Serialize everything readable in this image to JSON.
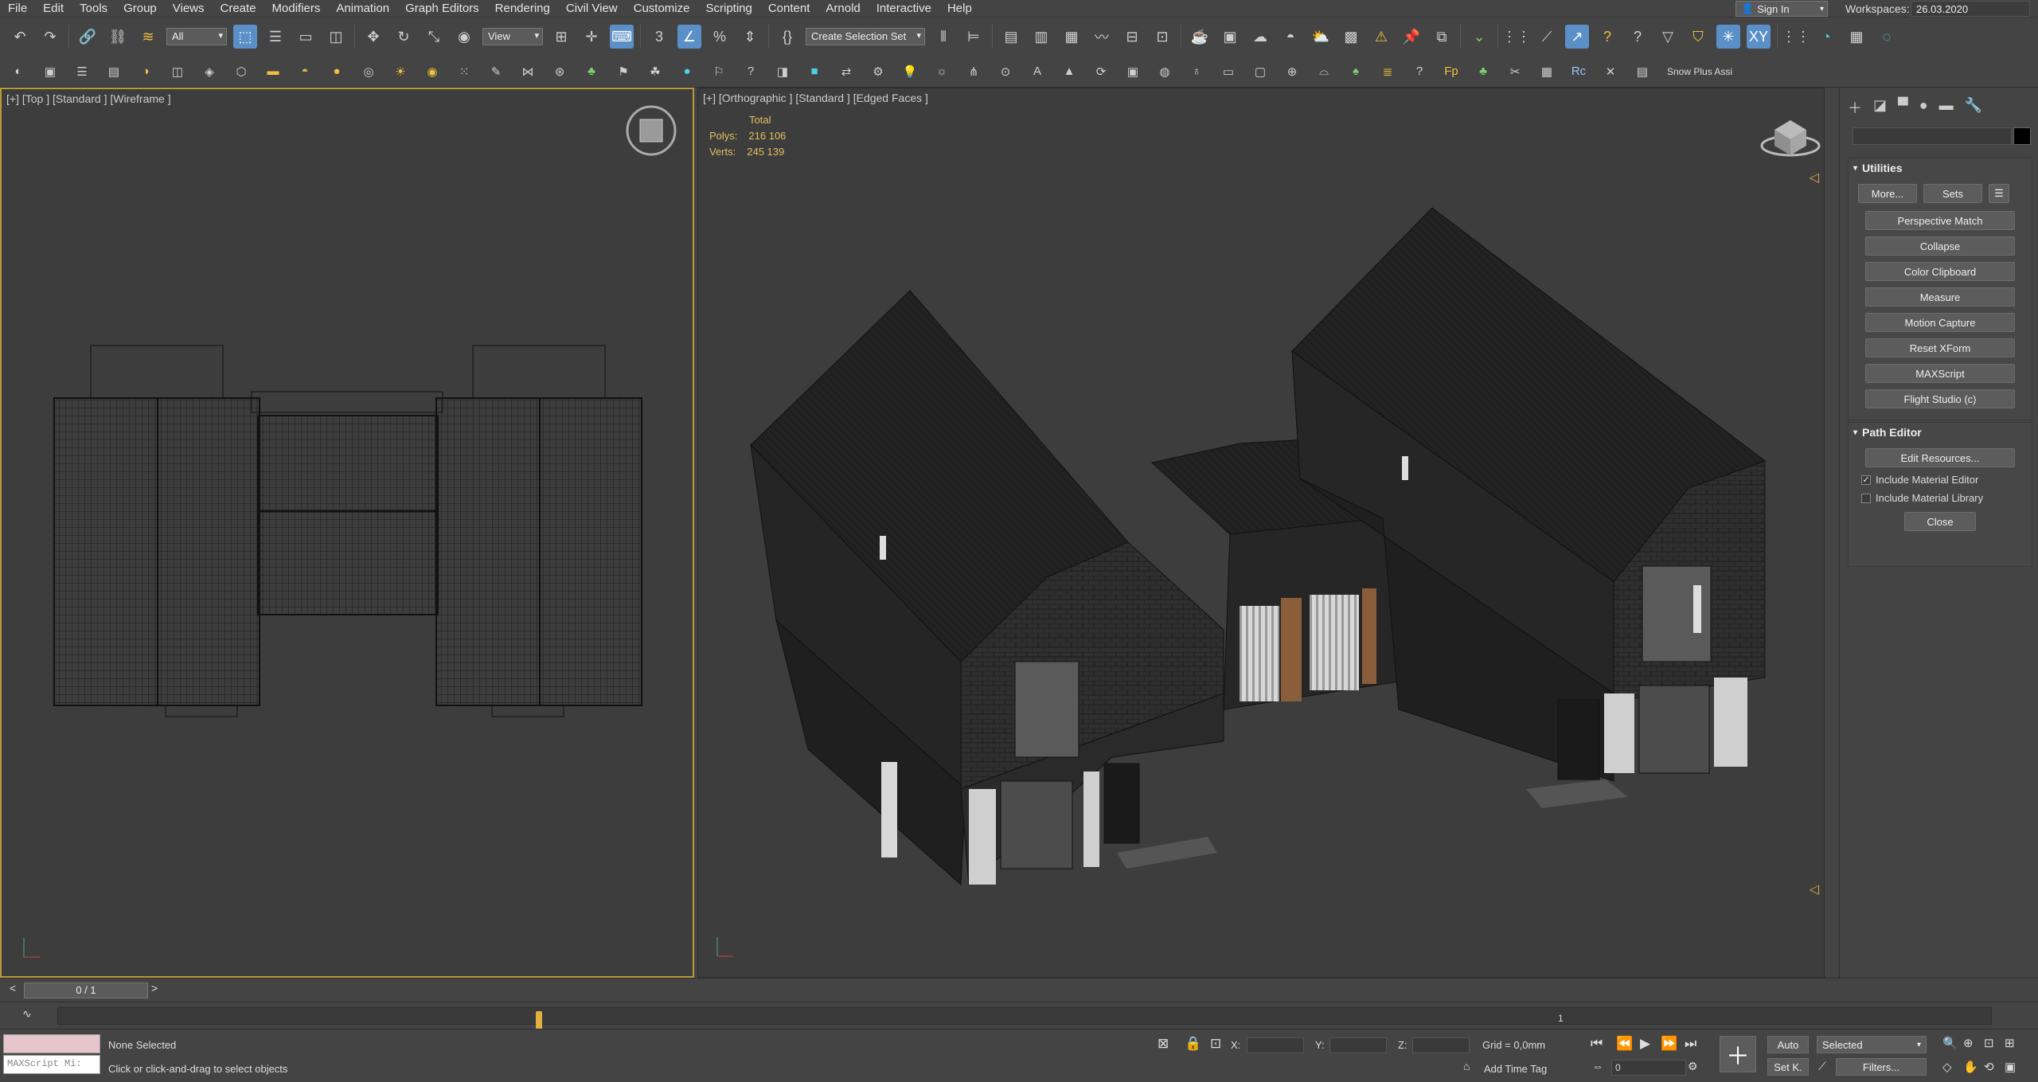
{
  "menu": {
    "items": [
      "File",
      "Edit",
      "Tools",
      "Group",
      "Views",
      "Create",
      "Modifiers",
      "Animation",
      "Graph Editors",
      "Rendering",
      "Civil View",
      "Customize",
      "Scripting",
      "Content",
      "Arnold",
      "Interactive",
      "Help"
    ]
  },
  "account": {
    "sign_in": "Sign In",
    "workspaces_label": "Workspaces:",
    "workspace_value": "26.03.2020"
  },
  "toolbar": {
    "selection_filter": "All",
    "ref_coord": "View",
    "selection_set": "Create Selection Set",
    "snow_plus": "Snow Plus Assi"
  },
  "viewports": {
    "left_label": "[+] [Top ] [Standard ] [Wireframe ]",
    "right_label": "[+] [Orthographic ] [Standard ] [Edged Faces ]",
    "stats": {
      "total_label": "Total",
      "polys_label": "Polys:",
      "polys_value": "216 106",
      "verts_label": "Verts:",
      "verts_value": "245 139"
    }
  },
  "command_panel": {
    "utilities_title": "Utilities",
    "more_btn": "More...",
    "sets_btn": "Sets",
    "utilities": [
      "Perspective Match",
      "Collapse",
      "Color Clipboard",
      "Measure",
      "Motion Capture",
      "Reset XForm",
      "MAXScript",
      "Flight Studio (c)"
    ],
    "path_editor_title": "Path Editor",
    "edit_resources": "Edit Resources...",
    "include_material_editor": "Include Material Editor",
    "include_material_editor_checked": true,
    "include_material_library": "Include Material Library",
    "include_material_library_checked": false,
    "close_btn": "Close"
  },
  "timeline": {
    "frame_display": "0 / 1",
    "tick_label": "1",
    "current_frame": 0,
    "total_frames": 1
  },
  "status": {
    "maxscript_placeholder": "MAXScript Mi:",
    "selection": "None Selected",
    "prompt": "Click or click-and-drag to select objects",
    "x_label": "X:",
    "y_label": "Y:",
    "z_label": "Z:",
    "grid": "Grid = 0,0mm",
    "add_time_tag": "Add Time Tag",
    "auto_key": "Auto",
    "set_key": "Set K.",
    "key_mode": "Selected",
    "filters": "Filters...",
    "frame_value": "0"
  }
}
